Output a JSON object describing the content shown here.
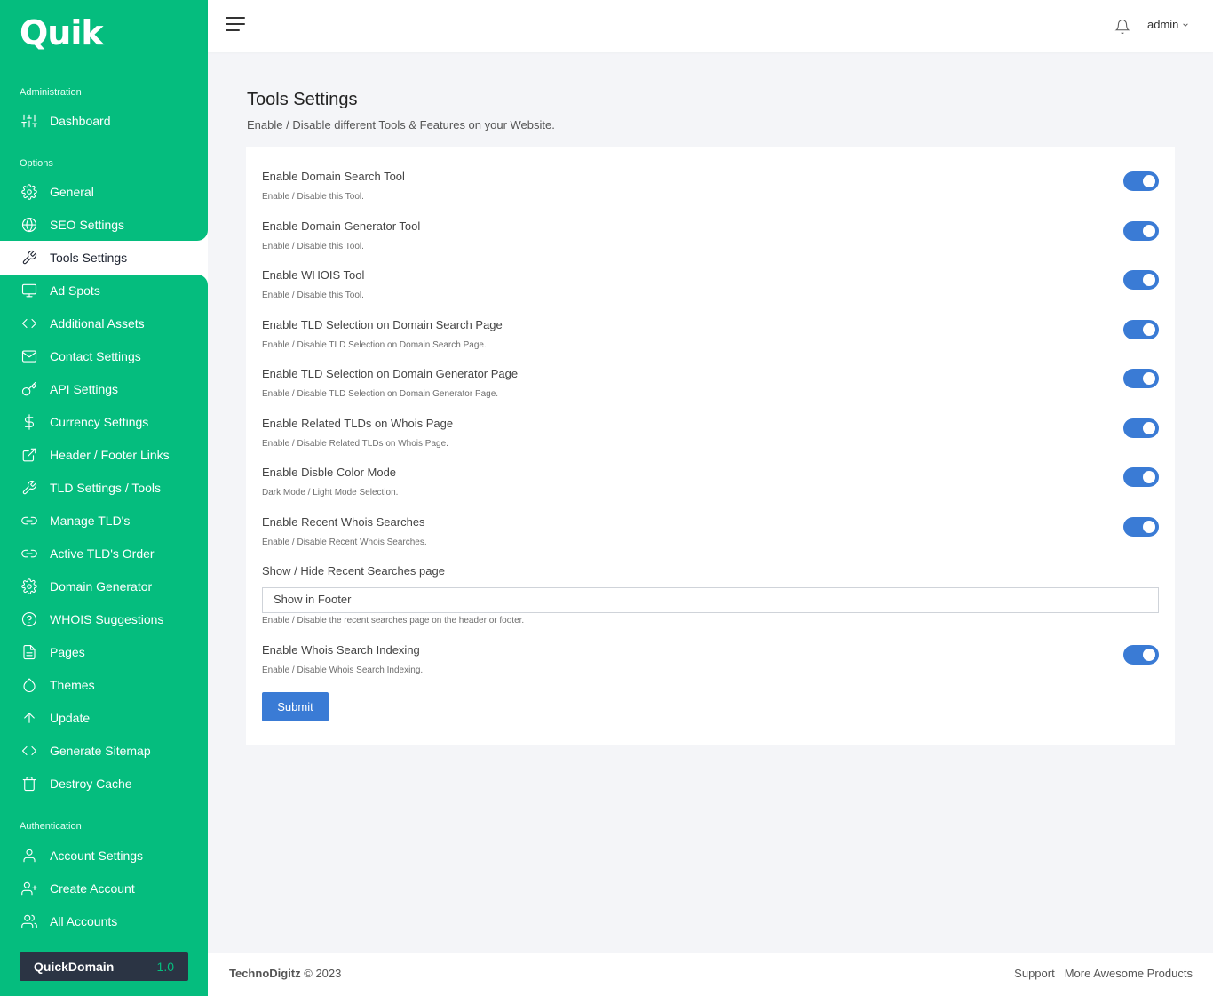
{
  "brand": {
    "logo": "Quik"
  },
  "sidebar": {
    "sections": {
      "administration": "Administration",
      "options": "Options",
      "authentication": "Authentication"
    },
    "items": [
      {
        "label": "Dashboard",
        "icon": "sliders-icon"
      },
      {
        "label": "General",
        "icon": "gear-icon"
      },
      {
        "label": "SEO Settings",
        "icon": "globe-icon"
      },
      {
        "label": "Tools Settings",
        "icon": "wrench-icon",
        "active": true
      },
      {
        "label": "Ad Spots",
        "icon": "monitor-icon"
      },
      {
        "label": "Additional Assets",
        "icon": "code-icon"
      },
      {
        "label": "Contact Settings",
        "icon": "mail-icon"
      },
      {
        "label": "API Settings",
        "icon": "key-icon"
      },
      {
        "label": "Currency Settings",
        "icon": "dollar-icon"
      },
      {
        "label": "Header / Footer Links",
        "icon": "external-link-icon"
      },
      {
        "label": "TLD Settings / Tools",
        "icon": "wrench-icon"
      },
      {
        "label": "Manage TLD's",
        "icon": "link-icon"
      },
      {
        "label": "Active TLD's Order",
        "icon": "link-icon"
      },
      {
        "label": "Domain Generator",
        "icon": "gear-icon"
      },
      {
        "label": "WHOIS Suggestions",
        "icon": "help-circle-icon"
      },
      {
        "label": "Pages",
        "icon": "file-icon"
      },
      {
        "label": "Themes",
        "icon": "droplet-icon"
      },
      {
        "label": "Update",
        "icon": "arrow-up-icon"
      },
      {
        "label": "Generate Sitemap",
        "icon": "code-icon"
      },
      {
        "label": "Destroy Cache",
        "icon": "trash-icon"
      },
      {
        "label": "Account Settings",
        "icon": "user-icon"
      },
      {
        "label": "Create Account",
        "icon": "user-plus-icon"
      },
      {
        "label": "All Accounts",
        "icon": "users-icon"
      }
    ],
    "version_box": {
      "name": "QuickDomain",
      "version": "1.0"
    }
  },
  "topbar": {
    "user": "admin"
  },
  "page": {
    "title": "Tools Settings",
    "subtitle": "Enable / Disable different Tools & Features on your Website."
  },
  "settings": [
    {
      "label": "Enable Domain Search Tool",
      "hint": "Enable / Disable this Tool.",
      "enabled": true
    },
    {
      "label": "Enable Domain Generator Tool",
      "hint": "Enable / Disable this Tool.",
      "enabled": true
    },
    {
      "label": "Enable WHOIS Tool",
      "hint": "Enable / Disable this Tool.",
      "enabled": true
    },
    {
      "label": "Enable TLD Selection on Domain Search Page",
      "hint": "Enable / Disable TLD Selection on Domain Search Page.",
      "enabled": true
    },
    {
      "label": "Enable TLD Selection on Domain Generator Page",
      "hint": "Enable / Disable TLD Selection on Domain Generator Page.",
      "enabled": true
    },
    {
      "label": "Enable Related TLDs on Whois Page",
      "hint": "Enable / Disable Related TLDs on Whois Page.",
      "enabled": true
    },
    {
      "label": "Enable Disble Color Mode",
      "hint": "Dark Mode / Light Mode Selection.",
      "enabled": true
    },
    {
      "label": "Enable Recent Whois Searches",
      "hint": "Enable / Disable Recent Whois Searches.",
      "enabled": true
    }
  ],
  "recent_searches_page": {
    "label": "Show / Hide Recent Searches page",
    "selected": "Show in Footer",
    "hint": "Enable / Disable the recent searches page on the header or footer."
  },
  "indexing": {
    "label": "Enable Whois Search Indexing",
    "hint": "Enable / Disable Whois Search Indexing.",
    "enabled": true
  },
  "submit_label": "Submit",
  "footer": {
    "company": "TechnoDigitz",
    "copyright": "© 2023",
    "links": [
      "Support",
      "More Awesome Products"
    ]
  },
  "colors": {
    "sidebar": "#05bd7e",
    "accent": "#3a7bd5",
    "version_box": "#2b3444"
  }
}
